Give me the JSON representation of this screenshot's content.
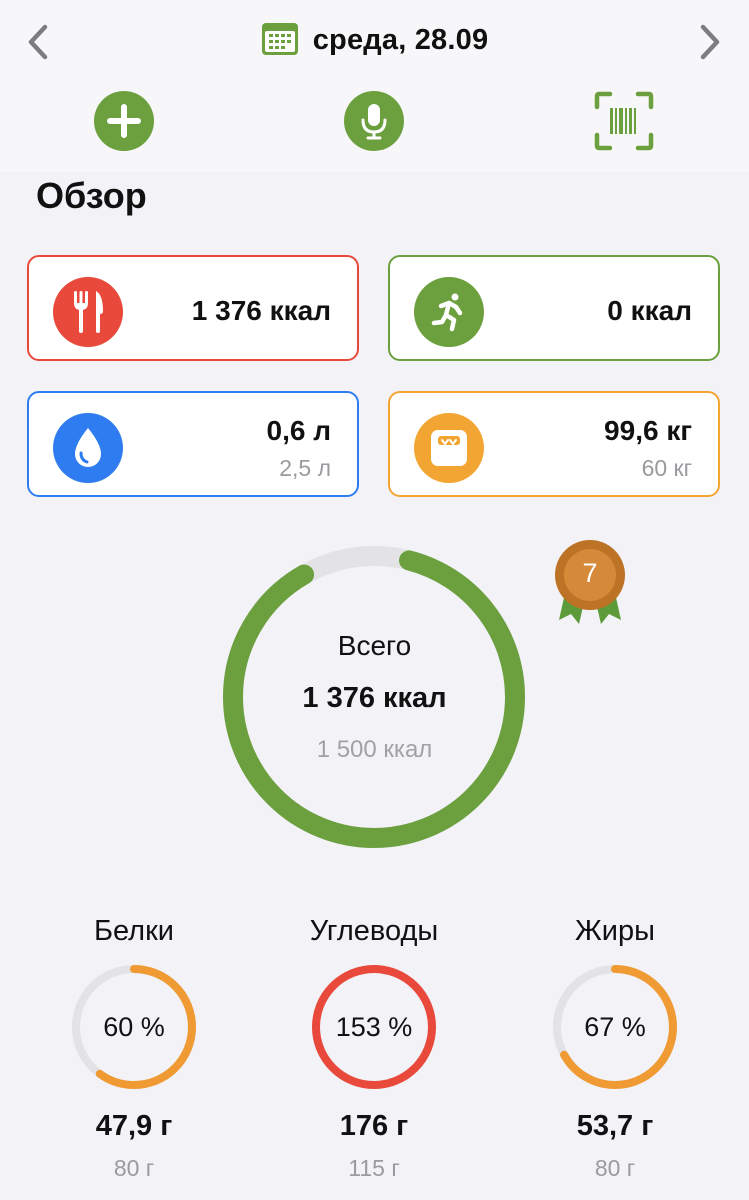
{
  "header": {
    "date": "среда, 28.09",
    "prev_icon": "chevron-left-icon",
    "next_icon": "chevron-right-icon",
    "calendar_icon": "calendar-icon",
    "actions": [
      {
        "name": "add",
        "icon": "plus-icon"
      },
      {
        "name": "voice",
        "icon": "microphone-icon"
      },
      {
        "name": "scan",
        "icon": "barcode-scan-icon"
      }
    ]
  },
  "overview": {
    "title": "Обзор",
    "cards": {
      "food": {
        "value": "1 376 ккал",
        "icon": "fork-knife-icon",
        "color": "#e8493b"
      },
      "activity": {
        "value": "0 ккал",
        "icon": "running-icon",
        "color": "#6c9f3e"
      },
      "water": {
        "value": "0,6 л",
        "goal": "2,5 л",
        "icon": "water-drop-icon",
        "color": "#2f7cf0"
      },
      "weight": {
        "value": "99,6 кг",
        "goal": "60 кг",
        "icon": "scale-icon",
        "color": "#f3a533"
      }
    }
  },
  "total": {
    "label": "Всего",
    "value": "1 376 ккал",
    "goal": "1 500 ккал",
    "progress": 0.917,
    "badge": "7",
    "badge_icon": "medal-icon"
  },
  "macros": [
    {
      "name": "Белки",
      "percent": "60 %",
      "value": "47,9 г",
      "goal": "80 г",
      "progress": 0.6,
      "color": "#f09a33"
    },
    {
      "name": "Углеводы",
      "percent": "153 %",
      "value": "176 г",
      "goal": "115 г",
      "progress": 1.0,
      "color": "#e8493b"
    },
    {
      "name": "Жиры",
      "percent": "67 %",
      "value": "53,7 г",
      "goal": "80 г",
      "progress": 0.67,
      "color": "#f09a33"
    }
  ],
  "colors": {
    "accent_green": "#6c9f3e",
    "ring_track": "#e3e3e6"
  }
}
